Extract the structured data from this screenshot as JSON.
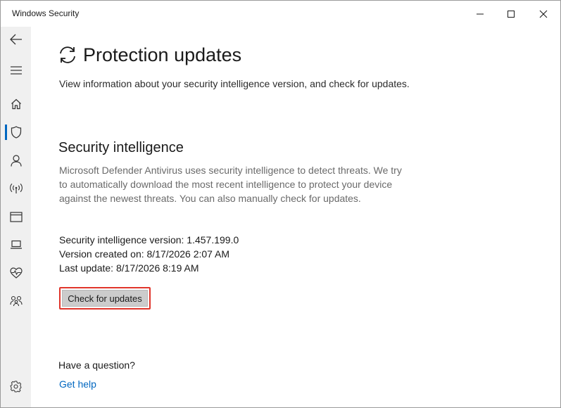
{
  "window": {
    "title": "Windows Security"
  },
  "sidebar": {
    "items": [
      {
        "icon": "back-arrow-icon"
      },
      {
        "icon": "hamburger-menu-icon"
      },
      {
        "icon": "home-icon"
      },
      {
        "icon": "shield-icon",
        "active": true
      },
      {
        "icon": "person-icon"
      },
      {
        "icon": "wireless-signal-icon"
      },
      {
        "icon": "app-window-icon"
      },
      {
        "icon": "laptop-icon"
      },
      {
        "icon": "heart-pulse-icon"
      },
      {
        "icon": "family-icon"
      },
      {
        "icon": "gear-icon"
      }
    ]
  },
  "page": {
    "title": "Protection updates",
    "intro": "View information about your security intelligence version, and check for updates."
  },
  "security_intelligence": {
    "heading": "Security intelligence",
    "description": "Microsoft Defender Antivirus uses security intelligence to detect threats. We try to automatically download the most recent intelligence to protect your device against the newest threats. You can also manually check for updates.",
    "version_line": "Security intelligence version: 1.457.199.0",
    "created_line": "Version created on: 8/17/2026 2:07 AM",
    "last_update_line": "Last update: 8/17/2026 8:19 AM",
    "check_button": "Check for updates"
  },
  "help": {
    "question": "Have a question?",
    "link": "Get help"
  },
  "colors": {
    "accent": "#0067c0",
    "highlight": "#e0352b",
    "sidebar_bg": "#f0f0f0"
  }
}
